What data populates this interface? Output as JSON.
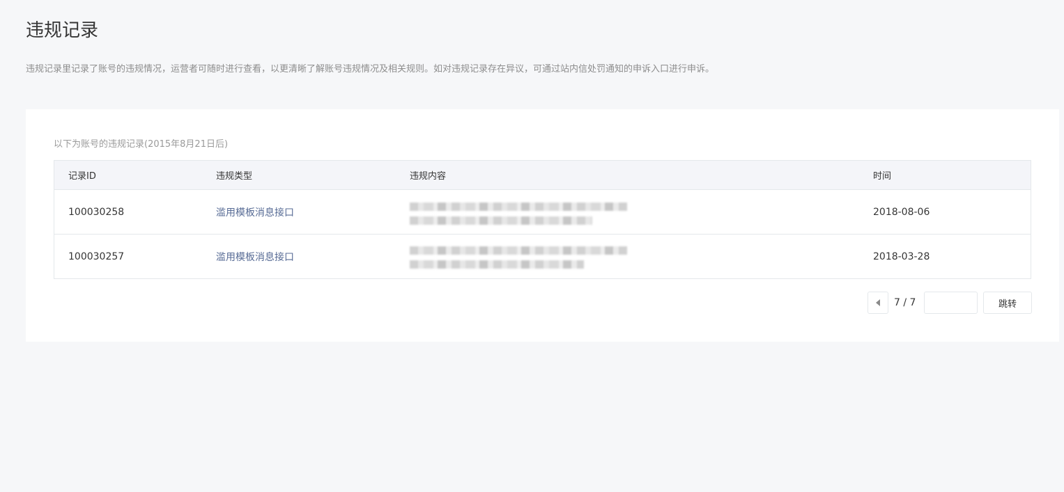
{
  "page": {
    "title": "违规记录",
    "description": "违规记录里记录了账号的违规情况，运营者可随时进行查看，以更清晰了解账号违规情况及相关规则。如对违规记录存在异议，可通过站内信处罚通知的申诉入口进行申诉。"
  },
  "records": {
    "caption": "以下为账号的违规记录(2015年8月21日后)",
    "headers": {
      "id": "记录ID",
      "type": "违规类型",
      "content": "违规内容",
      "time": "时间"
    },
    "rows": [
      {
        "id": "100030258",
        "type": "滥用模板消息接口",
        "time": "2018-08-06"
      },
      {
        "id": "100030257",
        "type": "滥用模板消息接口",
        "time": "2018-03-28"
      }
    ]
  },
  "pagination": {
    "page_count": "7 / 7",
    "jump_input_value": "",
    "jump_label": "跳转",
    "prev_icon": "triangle-left-icon"
  },
  "colors": {
    "background": "#f6f7f9",
    "card": "#ffffff",
    "link": "#576b95",
    "border": "#e4e8eb",
    "header_bg": "#f4f5f9"
  }
}
